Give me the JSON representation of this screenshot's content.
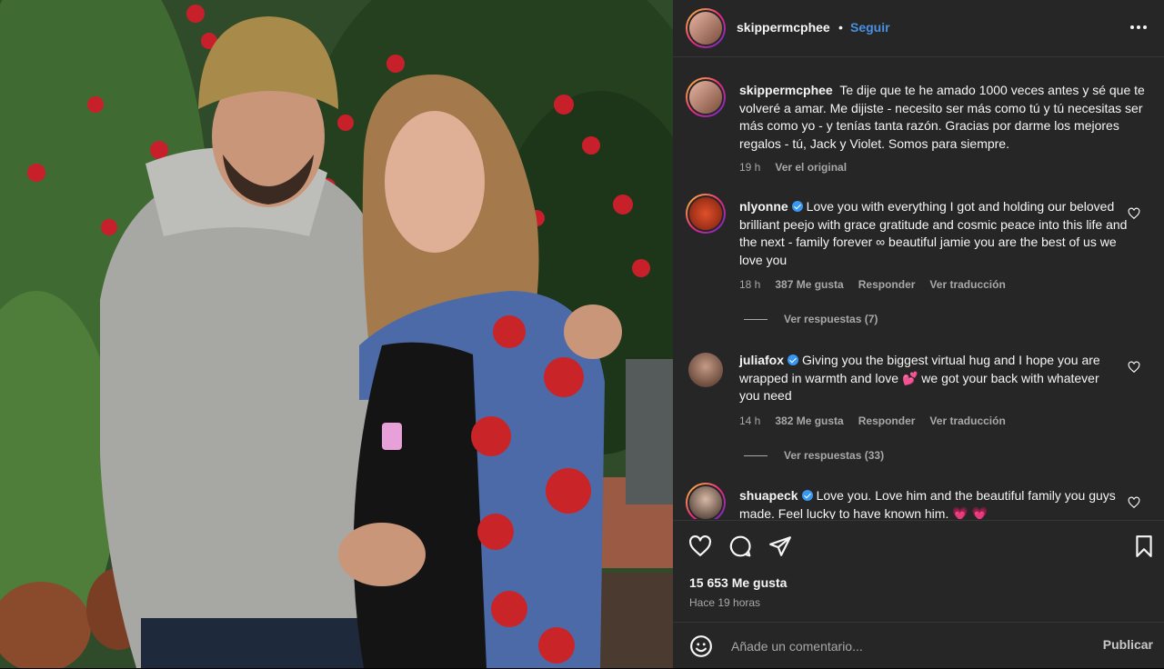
{
  "post": {
    "author": "skippermcphee",
    "follow_label": "Seguir",
    "separator": "•",
    "likes": "15 653 Me gusta",
    "time_ago": "Hace 19 horas",
    "comment_placeholder": "Añade un comentario...",
    "publish_label": "Publicar"
  },
  "caption": {
    "username": "skippermcphee",
    "text": "Te dije que te he amado 1000 veces antes y sé que te volveré a amar. Me dijiste - necesito ser más como tú y tú necesitas ser más como yo - y tenías tanta razón. Gracias por darme los mejores regalos - tú, Jack y Violet. Somos para siempre.",
    "time": "19 h",
    "see_original": "Ver el original"
  },
  "comments": [
    {
      "username": "nlyonne",
      "verified": true,
      "text": "Love you with everything I got and holding our beloved brilliant peejo with grace gratitude and cosmic peace into this life and the next - family forever ∞ beautiful jamie you are the best of us we love you",
      "time": "18 h",
      "likes": "387 Me gusta",
      "reply": "Responder",
      "translate": "Ver traducción",
      "replies": "Ver respuestas (7)"
    },
    {
      "username": "juliafox",
      "verified": true,
      "text": "Giving you the biggest virtual hug and I hope you are wrapped in warmth and love 💕 we got your back with whatever you need",
      "time": "14 h",
      "likes": "382 Me gusta",
      "reply": "Responder",
      "translate": "Ver traducción",
      "replies": "Ver respuestas (33)"
    },
    {
      "username": "shuapeck",
      "verified": true,
      "text": "Love you. Love him and the beautiful family you guys made. Feel lucky to have known him. 💗 💗"
    }
  ],
  "icons": {
    "like": "heart-icon",
    "comment": "comment-icon",
    "share": "share-icon",
    "save": "bookmark-icon",
    "emoji": "emoji-icon",
    "more": "more-options-icon"
  },
  "colors": {
    "panel_bg": "#262626",
    "follow": "#4a90e2",
    "muted": "#a8a8a8"
  }
}
